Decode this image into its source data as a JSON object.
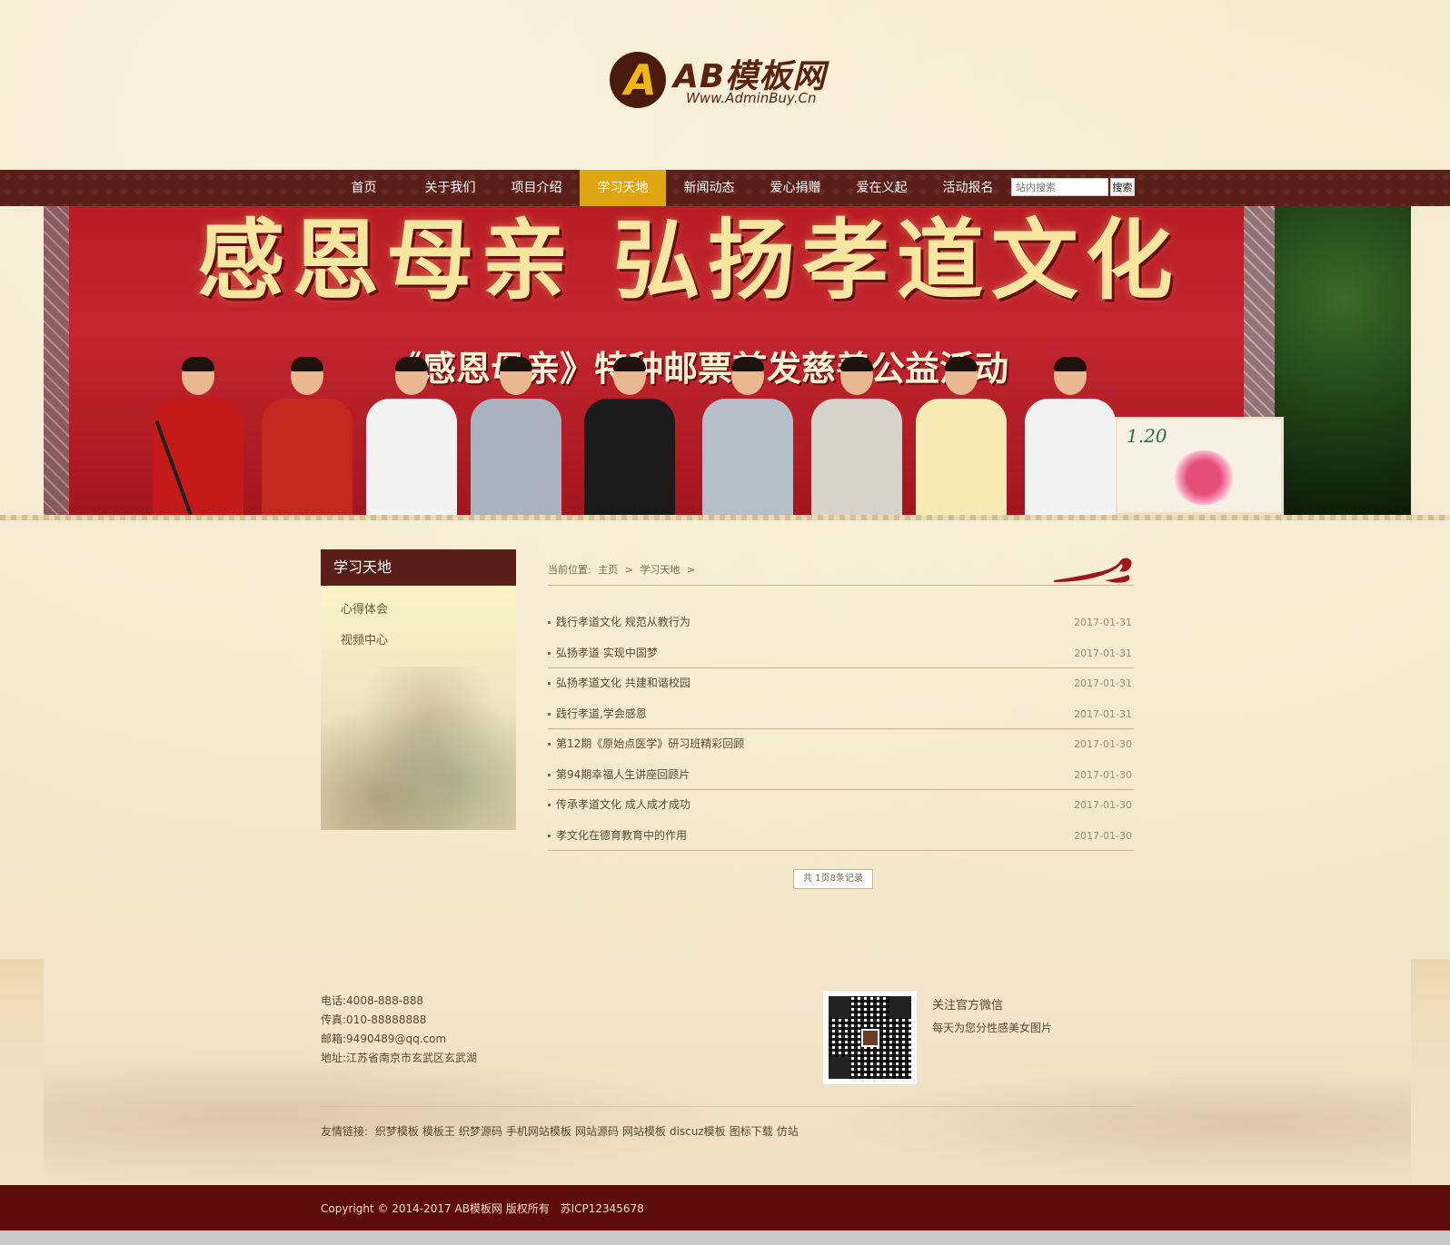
{
  "logo": {
    "mark": "A",
    "name": "AB模板网",
    "url": "Www.AdminBuy.Cn"
  },
  "nav": {
    "items": [
      {
        "label": "首页"
      },
      {
        "label": "关于我们"
      },
      {
        "label": "项目介绍"
      },
      {
        "label": "学习天地"
      },
      {
        "label": "新闻动态"
      },
      {
        "label": "爱心捐赠"
      },
      {
        "label": "爱在义起"
      },
      {
        "label": "活动报名"
      }
    ],
    "active_label": "学习天地",
    "search_placeholder": "站内搜索",
    "search_button": "搜索"
  },
  "banner": {
    "title": "感恩母亲 弘扬孝道文化",
    "subtitle": "《感恩母亲》特种邮票首发慈善公益活动",
    "stamp_value": "1.20"
  },
  "sidebar": {
    "title": "学习天地",
    "items": [
      "心得体会",
      "视频中心"
    ]
  },
  "breadcrumb": {
    "prefix": "当前位置:",
    "home": "主页",
    "sep1": ">",
    "current": "学习天地",
    "sep2": ">"
  },
  "news": [
    {
      "title": "践行孝道文化 规范从教行为",
      "date": "2017-01-31"
    },
    {
      "title": "弘扬孝道 实现中国梦",
      "date": "2017-01-31"
    },
    {
      "title": "弘扬孝道文化 共建和谐校园",
      "date": "2017-01-31"
    },
    {
      "title": "践行孝道,学会感恩",
      "date": "2017-01-31"
    },
    {
      "title": "第12期《原始点医学》研习班精彩回顾",
      "date": "2017-01-30"
    },
    {
      "title": "第94期幸福人生讲座回顾片",
      "date": "2017-01-30"
    },
    {
      "title": "传承孝道文化 成人成才成功",
      "date": "2017-01-30"
    },
    {
      "title": "孝文化在德育教育中的作用",
      "date": "2017-01-30"
    }
  ],
  "pager": "共 1页8条记录",
  "footer": {
    "phone": "电话:4008-888-888",
    "fax": "传真:010-88888888",
    "email": "邮箱:9490489@qq.com",
    "address": "地址:江苏省南京市玄武区玄武湖",
    "wechat_title": "关注官方微信",
    "wechat_sub": "每天为您分性感美女图片",
    "links_label": "友情链接:",
    "links": [
      "织梦模板",
      "模板王",
      "织梦源码",
      "手机网站模板",
      "网站源码",
      "网站模板",
      "discuz模板",
      "图标下载",
      "仿站"
    ],
    "copyright": "Copyright © 2014-2017 AB模板网 版权所有",
    "icp": "苏ICP12345678"
  },
  "colors": {
    "nav_bg": "#5b1f1a",
    "nav_active": "#e0a512",
    "page_bg": "#f2e5c7",
    "footer_bar": "#5e0c0c"
  }
}
